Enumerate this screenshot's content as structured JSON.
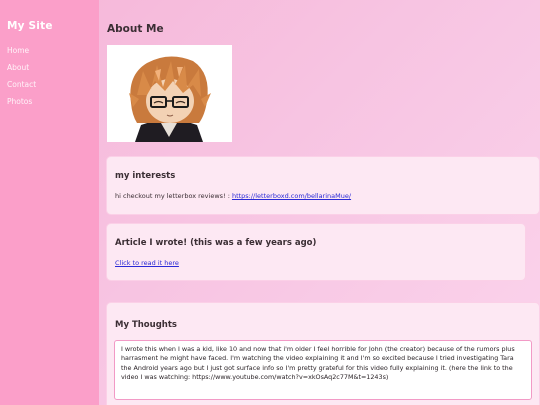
{
  "sidebar": {
    "site_title": "My Site",
    "nav": [
      {
        "label": "Home"
      },
      {
        "label": "About"
      },
      {
        "label": "Contact"
      },
      {
        "label": "Photos"
      }
    ]
  },
  "main": {
    "title": "About Me",
    "avatar": {
      "alt": "anime character with glasses"
    },
    "interests": {
      "heading": "my interests",
      "text_prefix": "hi checkout my letterbox reviews! : ",
      "link_text": "https://letterboxd.com/bellarinaMue/"
    },
    "article": {
      "heading": "Article I wrote! (this was a few years ago)",
      "link_text": "Click to read it here"
    },
    "thoughts": {
      "heading": "My Thoughts",
      "body": "I wrote this when I was a kid, like 10 and now that i'm older I feel horrible for John (the creator) because of the rumors plus harrasment he might have faced. I'm watching the video explaining it and I'm so excited because I tried investigating Tara the Android years ago but I just got surface info so I'm pretty grateful for this video fully explaining it. (here the link to the video I was watching: https://www.youtube.com/watch?v=xkOsAq2c77M&t=1243s)"
    }
  },
  "colors": {
    "sidebar_bg": "#fb9fc9",
    "page_bg": "#f7c4e2",
    "card_bg": "#fde8f3",
    "link": "#2a2ad6"
  },
  "icons": {
    "avatar": "anime-avatar-image"
  }
}
